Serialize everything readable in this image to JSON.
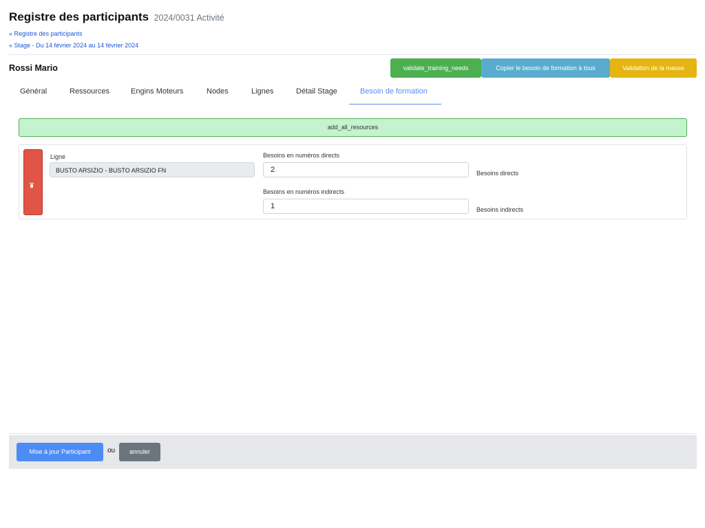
{
  "header": {
    "title": "Registre des participants",
    "subtitle": "2024/0031 Activité"
  },
  "breadcrumbs": [
    {
      "label": "« Registre des participants"
    },
    {
      "label": "« Stage - Du 14 février 2024 au 14 février 2024"
    }
  ],
  "participant": {
    "name": "Rossi Mario"
  },
  "actions": {
    "validate_label": "validate_training_needs",
    "copy_label": "Copier le besoin de formation à tous",
    "mass_label": "Validation de la masse"
  },
  "tabs": [
    {
      "label": "Général"
    },
    {
      "label": "Ressources"
    },
    {
      "label": "Engins Moteurs"
    },
    {
      "label": "Nodes"
    },
    {
      "label": "Lignes"
    },
    {
      "label": "Détail Stage"
    },
    {
      "label": "Besoin de formation",
      "active": true
    }
  ],
  "add_all_label": "add_all_resources",
  "need": {
    "ligne_label": "Ligne",
    "ligne_value": "BUSTO ARSIZIO - BUSTO ARSIZIO FN",
    "direct_label": "Besoins en numéros directs",
    "direct_value": "2",
    "direct_unit": "Besoins directs",
    "indirect_label": "Besoins en numéros indirects",
    "indirect_value": "1",
    "indirect_unit": "Besoins indirects"
  },
  "footer": {
    "update_label": "Mise à jour Participant",
    "or_label": "ou",
    "cancel_label": "annuler"
  },
  "colors": {
    "validate": "#4caf50",
    "copy": "#5aaccf",
    "mass": "#e6b512",
    "delete": "#e05545",
    "primary": "#4d8cf5",
    "secondary": "#6c757d",
    "link": "#1a56db",
    "active_tab": "#5b8def"
  },
  "icons": {
    "delete": "trash-icon"
  }
}
